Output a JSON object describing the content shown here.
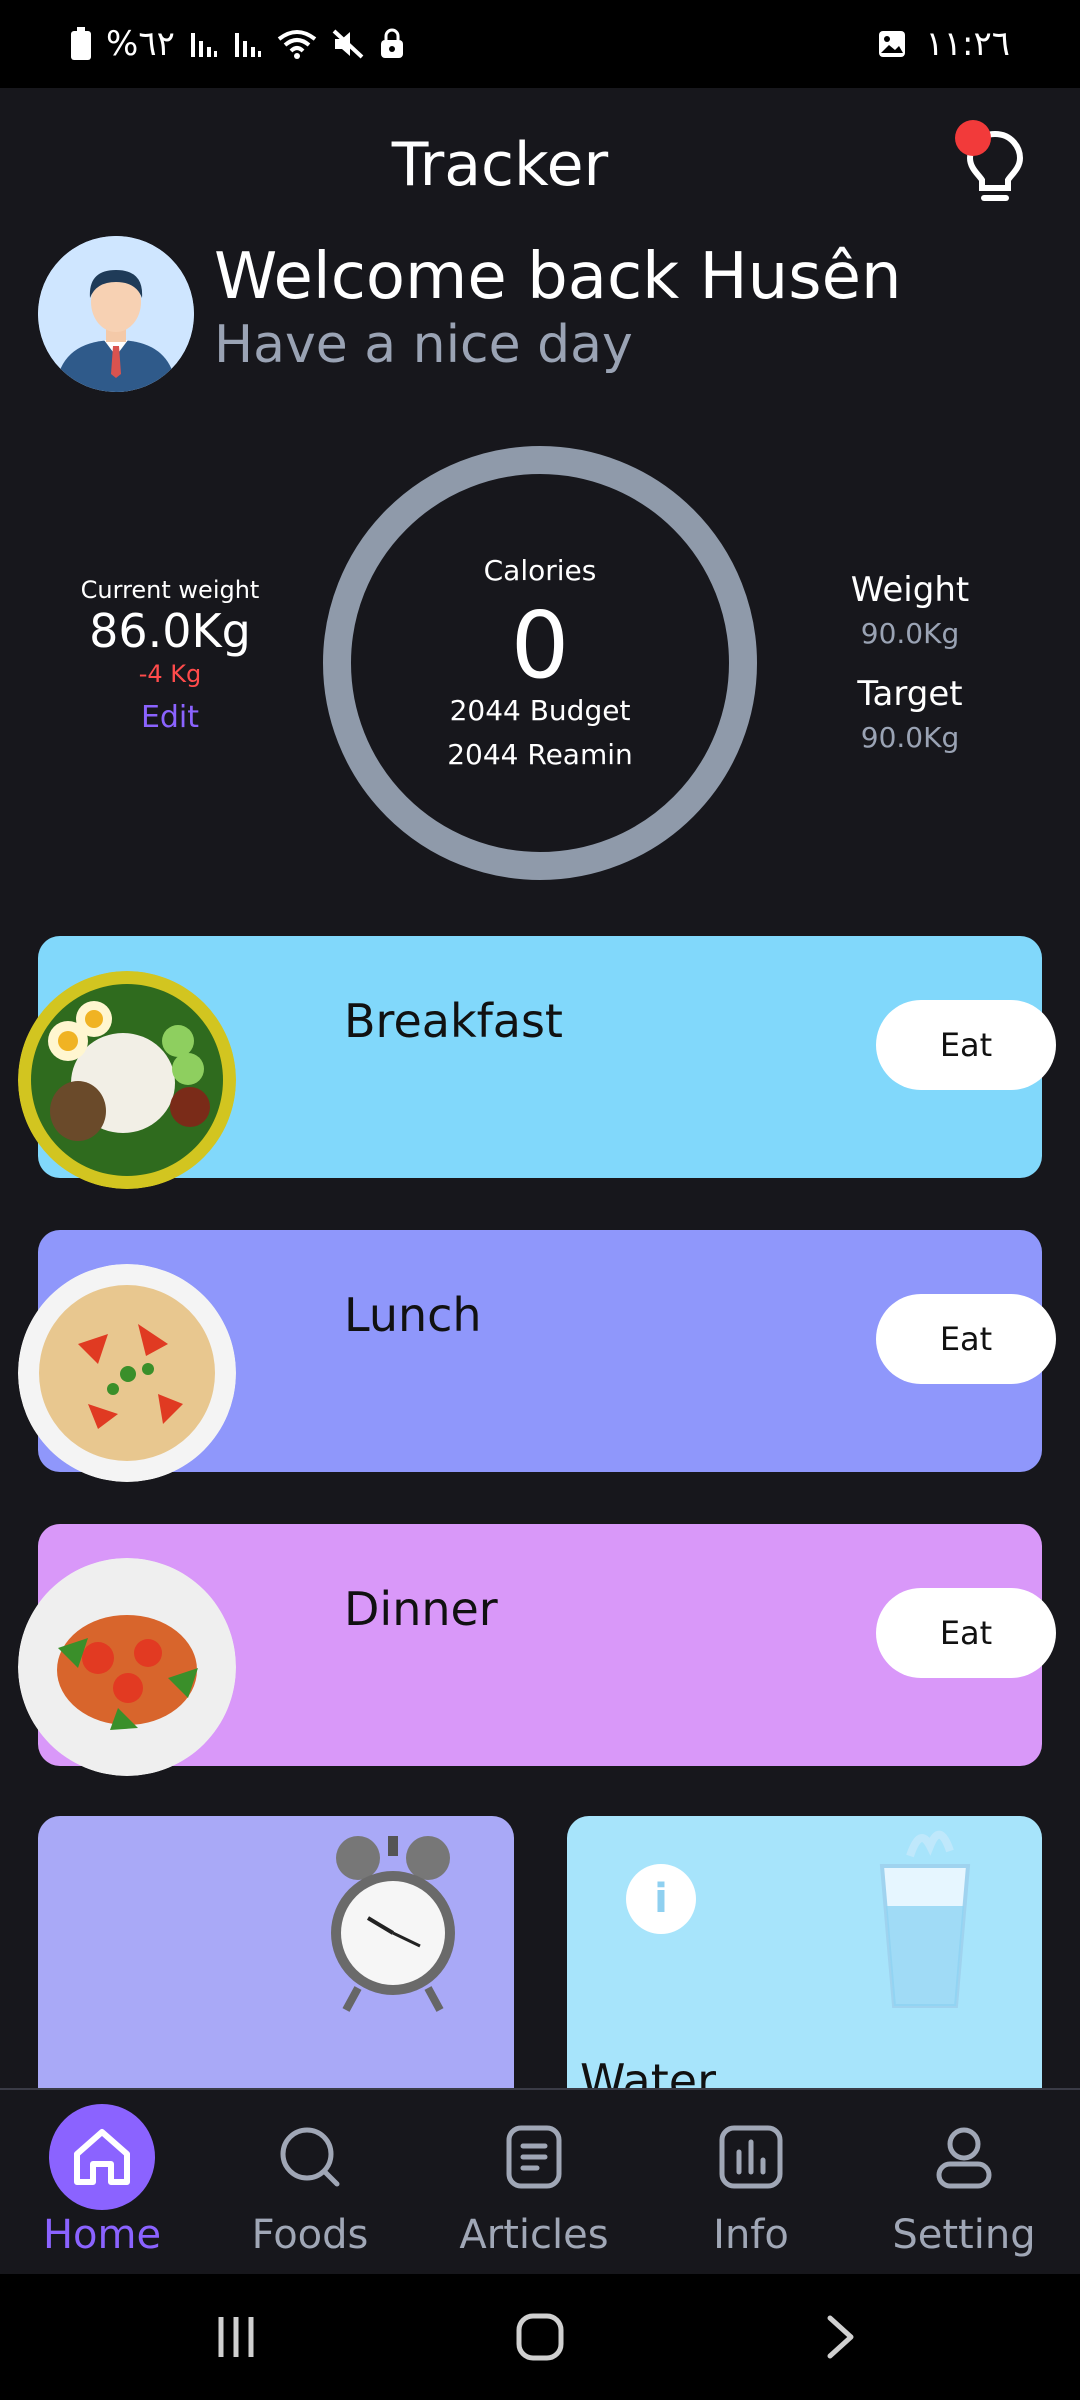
{
  "status_bar": {
    "battery_text": "%٦٢",
    "time": "١١:٢٦"
  },
  "header": {
    "title": "Tracker"
  },
  "profile": {
    "welcome": "Welcome back Husên",
    "subtitle": "Have a nice day"
  },
  "stats": {
    "current_weight_label": "Current weight",
    "current_weight_value": "86.0Kg",
    "weight_delta": "-4 Kg",
    "edit_label": "Edit",
    "calories_label": "Calories",
    "calories_value": "0",
    "budget_text": "2044 Budget",
    "remain_text": "2044 Reamin",
    "weight_label": "Weight",
    "weight_value": "90.0Kg",
    "target_label": "Target",
    "target_value": "90.0Kg"
  },
  "meals": [
    {
      "name": "Breakfast",
      "button": "Eat",
      "color": "#81d8fb"
    },
    {
      "name": "Lunch",
      "button": "Eat",
      "color": "#8f97fb"
    },
    {
      "name": "Dinner",
      "button": "Eat",
      "color": "#d998f9"
    }
  ],
  "tiles": {
    "left_color": "#a9a9f7",
    "right_color": "#a7e4fb",
    "info_icon": "info-icon",
    "water_partial_label": "Water"
  },
  "nav": {
    "items": [
      {
        "label": "Home",
        "icon": "home-icon",
        "active": true
      },
      {
        "label": "Foods",
        "icon": "search-icon",
        "active": false
      },
      {
        "label": "Articles",
        "icon": "article-icon",
        "active": false
      },
      {
        "label": "Info",
        "icon": "chart-icon",
        "active": false
      },
      {
        "label": "Setting",
        "icon": "profile-icon",
        "active": false
      }
    ]
  },
  "colors": {
    "accent": "#8b63ff",
    "background": "#17171c",
    "ring": "#8f9aaa",
    "delta": "#ff4b4b"
  }
}
